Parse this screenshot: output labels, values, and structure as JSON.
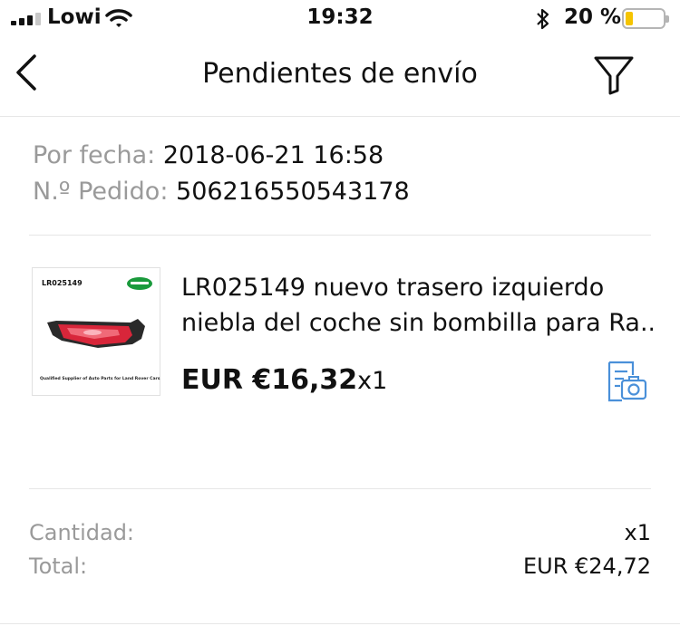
{
  "status_bar": {
    "carrier": "Lowi",
    "time": "19:32",
    "battery": "20 %",
    "battery_level": 0.2
  },
  "nav": {
    "title": "Pendientes de envío"
  },
  "order": {
    "date_label": "Por fecha:",
    "date_value": "2018-06-21 16:58",
    "number_label": "N.º Pedido:",
    "number_value": "506216550543178"
  },
  "product": {
    "thumbnail_code": "LR025149",
    "thumbnail_tagline": "Qualified Supplier of Auto Parts for Land Rover Cars",
    "title_line1": "LR025149 nuevo trasero izquierdo",
    "title_line2": "niebla del coche sin bombilla para Ra...",
    "price": "EUR €16,32",
    "quantity": "x1"
  },
  "summary": {
    "quantity_label": "Cantidad:",
    "quantity_value": "x1",
    "total_label": "Total:",
    "total_value": "EUR €24,72"
  },
  "colors": {
    "accent_blue": "#4a90d9",
    "label_gray": "#9a9a9a",
    "battery_yellow": "#f5c400"
  }
}
